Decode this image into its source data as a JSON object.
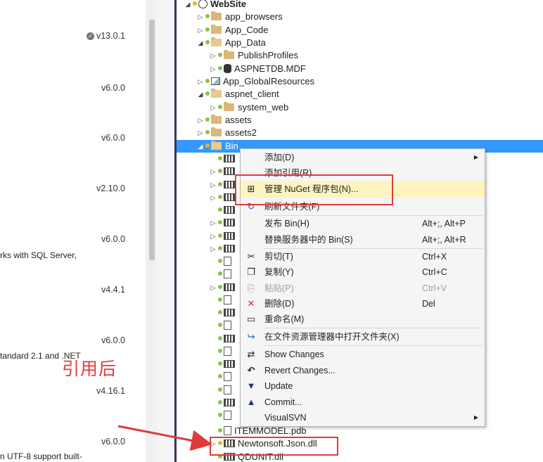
{
  "nuget_versions": [
    "v13.0.1",
    "v6.0.0",
    "v6.0.0",
    "v2.10.0",
    "v6.0.0",
    "v4.4.1",
    "v6.0.0",
    "v4.16.1",
    "v6.0.0"
  ],
  "nuget_fragments": [
    "rks with SQL Server,",
    "tandard 2.1 and .NET",
    "n UTF-8 support built-"
  ],
  "tree": {
    "root": "WebSite",
    "items": [
      {
        "label": "app_browsers"
      },
      {
        "label": "App_Code"
      },
      {
        "label": "App_Data"
      },
      {
        "label": "PublishProfiles"
      },
      {
        "label": "ASPNETDB.MDF"
      },
      {
        "label": "App_GlobalResources"
      },
      {
        "label": "aspnet_client"
      },
      {
        "label": "system_web"
      },
      {
        "label": "assets"
      },
      {
        "label": "assets2"
      },
      {
        "label": "Bin"
      }
    ],
    "bottom_items": [
      "ITEMMODEL.pdb",
      "Newtonsoft.Json.dll",
      "QDUNIT.dll"
    ]
  },
  "menu": {
    "items": [
      {
        "label": "添加(D)",
        "shortcut": "",
        "submenu": true,
        "icon": "",
        "name": "add"
      },
      {
        "label": "添加引用(R)...",
        "shortcut": "",
        "icon": "",
        "name": "add-reference"
      },
      {
        "label": "管理 NuGet 程序包(N)...",
        "shortcut": "",
        "icon": "nuget-icon",
        "name": "manage-nuget"
      },
      {
        "label": "刷新文件夹(F)",
        "shortcut": "",
        "icon": "refresh-icon",
        "name": "refresh-folder"
      },
      {
        "label": "发布 Bin(H)",
        "shortcut": "Alt+;, Alt+P",
        "icon": "",
        "name": "publish-bin"
      },
      {
        "label": "替换服务器中的 Bin(S)",
        "shortcut": "Alt+;, Alt+R",
        "icon": "",
        "name": "replace-bin"
      },
      {
        "label": "剪切(T)",
        "shortcut": "Ctrl+X",
        "icon": "cut-icon",
        "name": "cut"
      },
      {
        "label": "复制(Y)",
        "shortcut": "Ctrl+C",
        "icon": "copy-icon",
        "name": "copy"
      },
      {
        "label": "粘贴(P)",
        "shortcut": "Ctrl+V",
        "icon": "paste-icon",
        "name": "paste",
        "disabled": true
      },
      {
        "label": "删除(D)",
        "shortcut": "Del",
        "icon": "delete-icon",
        "name": "delete"
      },
      {
        "label": "重命名(M)",
        "shortcut": "",
        "icon": "rename-icon",
        "name": "rename"
      },
      {
        "label": "在文件资源管理器中打开文件夹(X)",
        "shortcut": "",
        "icon": "open-folder-icon",
        "name": "open-in-explorer"
      },
      {
        "label": "Show Changes",
        "shortcut": "",
        "icon": "show-changes-icon",
        "name": "show-changes"
      },
      {
        "label": "Revert Changes...",
        "shortcut": "",
        "icon": "revert-icon",
        "name": "revert-changes"
      },
      {
        "label": "Update",
        "shortcut": "",
        "icon": "update-icon",
        "name": "update"
      },
      {
        "label": "Commit...",
        "shortcut": "",
        "icon": "commit-icon",
        "name": "commit"
      },
      {
        "label": "VisualSVN",
        "shortcut": "",
        "submenu": true,
        "icon": "",
        "name": "visualsvn"
      }
    ]
  },
  "annotation": "引用后",
  "colors": {
    "selection": "#3399ff",
    "highlight": "#fdf4bf",
    "annotation": "#e03b3b"
  }
}
